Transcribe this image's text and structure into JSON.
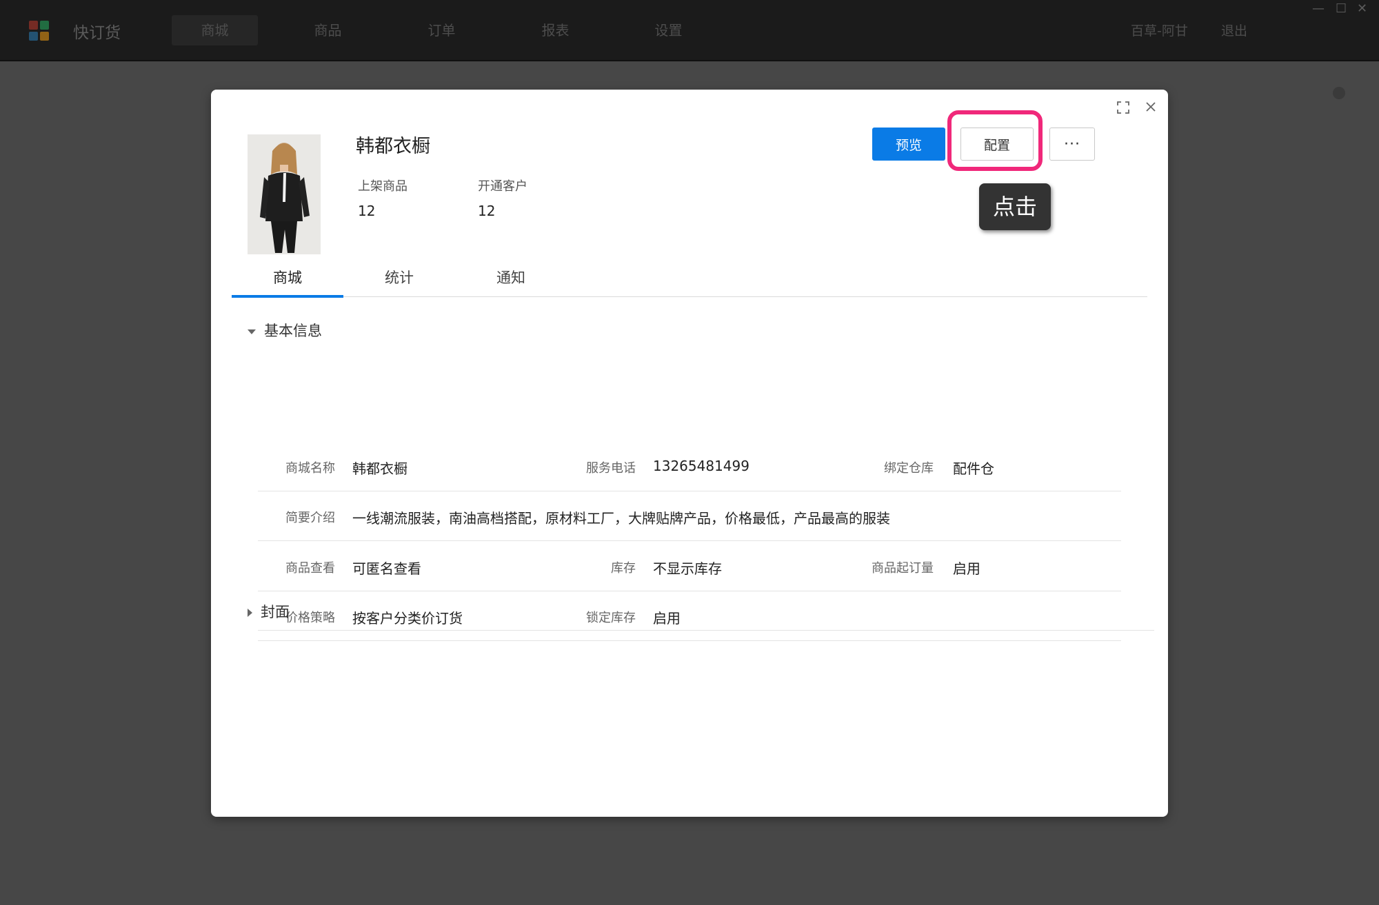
{
  "app": {
    "name": "快订货",
    "nav": [
      "商城",
      "商品",
      "订单",
      "报表",
      "设置"
    ],
    "user": "百草-阿甘",
    "logout": "退出",
    "window_controls": [
      "—",
      "☐",
      "✕"
    ]
  },
  "modal": {
    "shop_name": "韩都衣橱",
    "stats": [
      {
        "label": "上架商品",
        "value": "12"
      },
      {
        "label": "开通客户",
        "value": "12"
      }
    ],
    "buttons": {
      "preview": "预览",
      "config": "配置",
      "more": "···"
    },
    "tooltip": "点击",
    "tabs": [
      "商城",
      "统计",
      "通知"
    ],
    "active_tab": "商城",
    "sections": {
      "basic_info": "基本信息",
      "cover": "封面"
    },
    "fields": {
      "shop_name_label": "商城名称",
      "shop_name_value": "韩都衣橱",
      "phone_label": "服务电话",
      "phone_value": "13265481499",
      "warehouse_label": "绑定仓库",
      "warehouse_value": "配件仓",
      "intro_label": "简要介绍",
      "intro_value": "一线潮流服装，南油高档搭配，原材料工厂，大牌贴牌产品，价格最低，产品最高的服装",
      "view_label": "商品查看",
      "view_value": "可匿名查看",
      "stock_label": "库存",
      "stock_value": "不显示库存",
      "moq_label": "商品起订量",
      "moq_value": "启用",
      "price_label": "价格策略",
      "price_value": "按客户分类价订货",
      "lock_label": "锁定库存",
      "lock_value": "启用"
    }
  },
  "colors": {
    "primary": "#0a7be6",
    "highlight": "#f0287a",
    "overlay": "#474747",
    "tooltip_bg": "#333333"
  },
  "icons": [
    "expand-icon",
    "close-icon",
    "caret-down-icon",
    "caret-right-icon",
    "more-icon",
    "app-logo-icon"
  ]
}
